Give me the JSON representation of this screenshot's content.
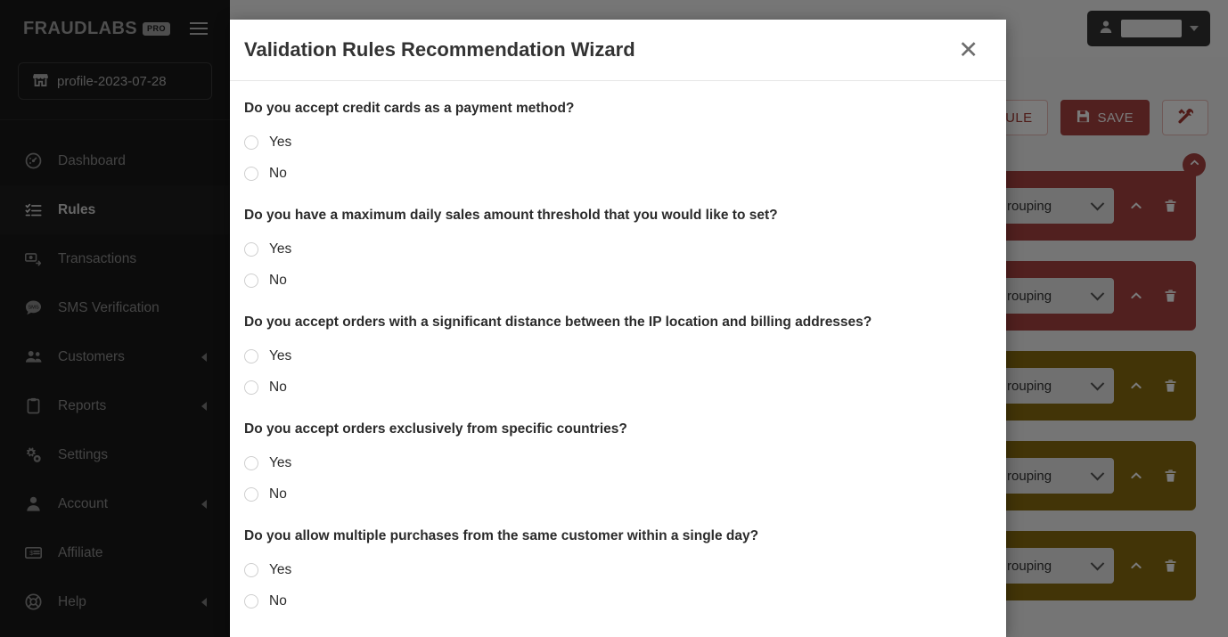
{
  "sidebar": {
    "brand": {
      "name": "FRAUDLABS",
      "badge": "PRO"
    },
    "profile": {
      "label": "profile-2023-07-28",
      "icon": "store-icon"
    },
    "items": [
      {
        "label": "Dashboard",
        "icon": "dashboard-icon",
        "active": false,
        "expandable": false
      },
      {
        "label": "Rules",
        "icon": "rules-checklist-icon",
        "active": true,
        "expandable": false
      },
      {
        "label": "Transactions",
        "icon": "transactions-icon",
        "active": false,
        "expandable": false
      },
      {
        "label": "SMS Verification",
        "icon": "sms-icon",
        "active": false,
        "expandable": false
      },
      {
        "label": "Customers",
        "icon": "customers-icon",
        "active": false,
        "expandable": true
      },
      {
        "label": "Reports",
        "icon": "clipboard-icon",
        "active": false,
        "expandable": true
      },
      {
        "label": "Settings",
        "icon": "gears-icon",
        "active": false,
        "expandable": false
      },
      {
        "label": "Account",
        "icon": "user-icon",
        "active": false,
        "expandable": true
      },
      {
        "label": "Affiliate",
        "icon": "money-card-icon",
        "active": false,
        "expandable": false
      },
      {
        "label": "Help",
        "icon": "lifebuoy-icon",
        "active": false,
        "expandable": true
      }
    ]
  },
  "topbar": {
    "account_button": {
      "icon": "user-icon",
      "name_masked": "",
      "caret": "chevron-down-icon"
    }
  },
  "toolbar": {
    "add_rule_label": "RULE",
    "save_label": "SAVE",
    "save_icon": "floppy-disk-icon",
    "tools_icon": "tools-icon",
    "collapse_all_icon": "chevron-up-icon"
  },
  "rules": [
    {
      "grouping": "No Grouping",
      "severity": "danger"
    },
    {
      "grouping": "No Grouping",
      "severity": "danger"
    },
    {
      "grouping": "No Grouping",
      "severity": "warning"
    },
    {
      "grouping": "No Grouping",
      "severity": "warning"
    },
    {
      "grouping": "No Grouping",
      "severity": "warning"
    }
  ],
  "rule_row_icons": {
    "collapse": "chevron-up-icon",
    "delete": "trash-icon",
    "select_caret": "chevron-down-icon"
  },
  "modal": {
    "title": "Validation Rules Recommendation Wizard",
    "close_icon": "close-icon",
    "questions": [
      {
        "text": "Do you accept credit cards as a payment method?",
        "options": [
          {
            "label": "Yes",
            "selected": false
          },
          {
            "label": "No",
            "selected": false
          }
        ]
      },
      {
        "text": "Do you have a maximum daily sales amount threshold that you would like to set?",
        "options": [
          {
            "label": "Yes",
            "selected": false
          },
          {
            "label": "No",
            "selected": false
          }
        ]
      },
      {
        "text": "Do you accept orders with a significant distance between the IP location and billing addresses?",
        "options": [
          {
            "label": "Yes",
            "selected": false
          },
          {
            "label": "No",
            "selected": false
          }
        ]
      },
      {
        "text": "Do you accept orders exclusively from specific countries?",
        "options": [
          {
            "label": "Yes",
            "selected": false
          },
          {
            "label": "No",
            "selected": false
          }
        ]
      },
      {
        "text": "Do you allow multiple purchases from the same customer within a single day?",
        "options": [
          {
            "label": "Yes",
            "selected": false
          },
          {
            "label": "No",
            "selected": false
          }
        ]
      }
    ]
  },
  "colors": {
    "sidebar_bg": "#191919",
    "danger": "#a94442",
    "warning": "#8a6d10",
    "overlay": "rgba(0,0,0,0.52)"
  }
}
